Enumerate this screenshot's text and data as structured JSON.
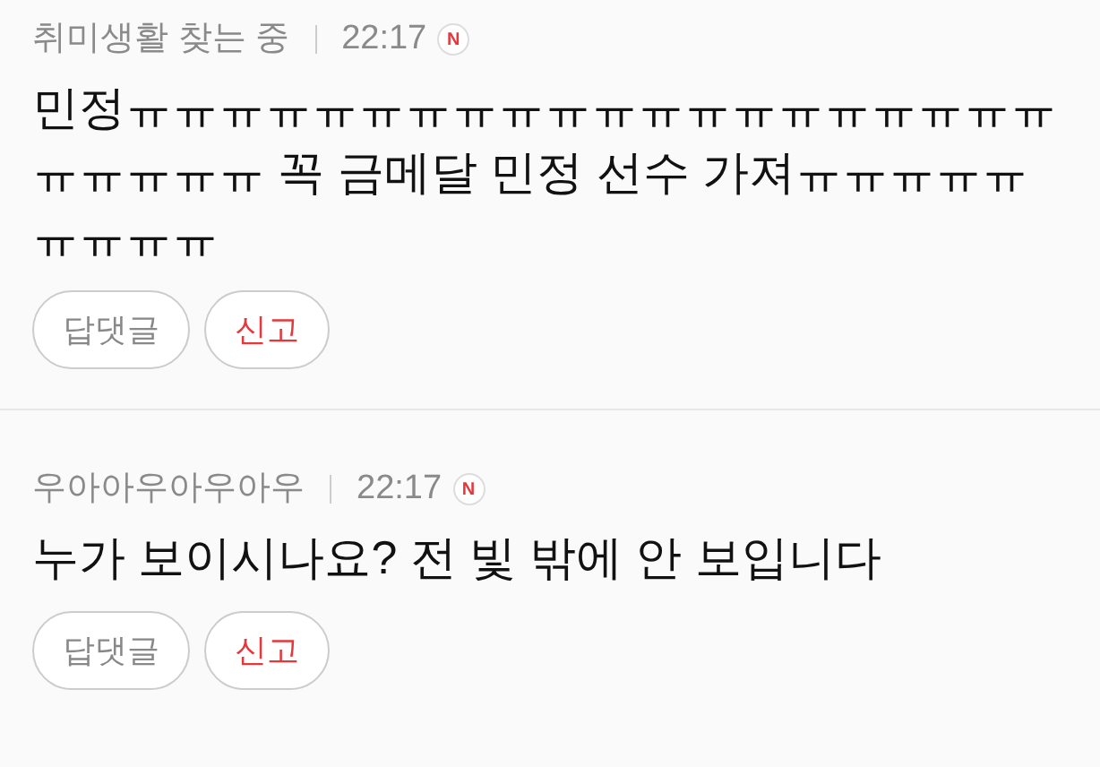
{
  "comments": [
    {
      "author": "취미생활 찾는 중",
      "time": "22:17",
      "badge": "N",
      "text": "민정ㅠㅠㅠㅠㅠㅠㅠㅠㅠㅠㅠㅠㅠㅠㅠㅠㅠㅠㅠㅠㅠㅠㅠㅠㅠ 꼭 금메달 민정 선수 가져ㅠㅠㅠㅠㅠㅠㅠㅠㅠ",
      "buttons": [
        {
          "label": "답댓글",
          "kind": "reply"
        },
        {
          "label": "신고",
          "kind": "report"
        }
      ]
    },
    {
      "author": "우아아우아우아우",
      "time": "22:17",
      "badge": "N",
      "text": "누가 보이시나요? 전 빛 밖에 안 보입니다",
      "buttons": [
        {
          "label": "답댓글",
          "kind": "reply"
        },
        {
          "label": "신고",
          "kind": "report"
        }
      ]
    }
  ]
}
